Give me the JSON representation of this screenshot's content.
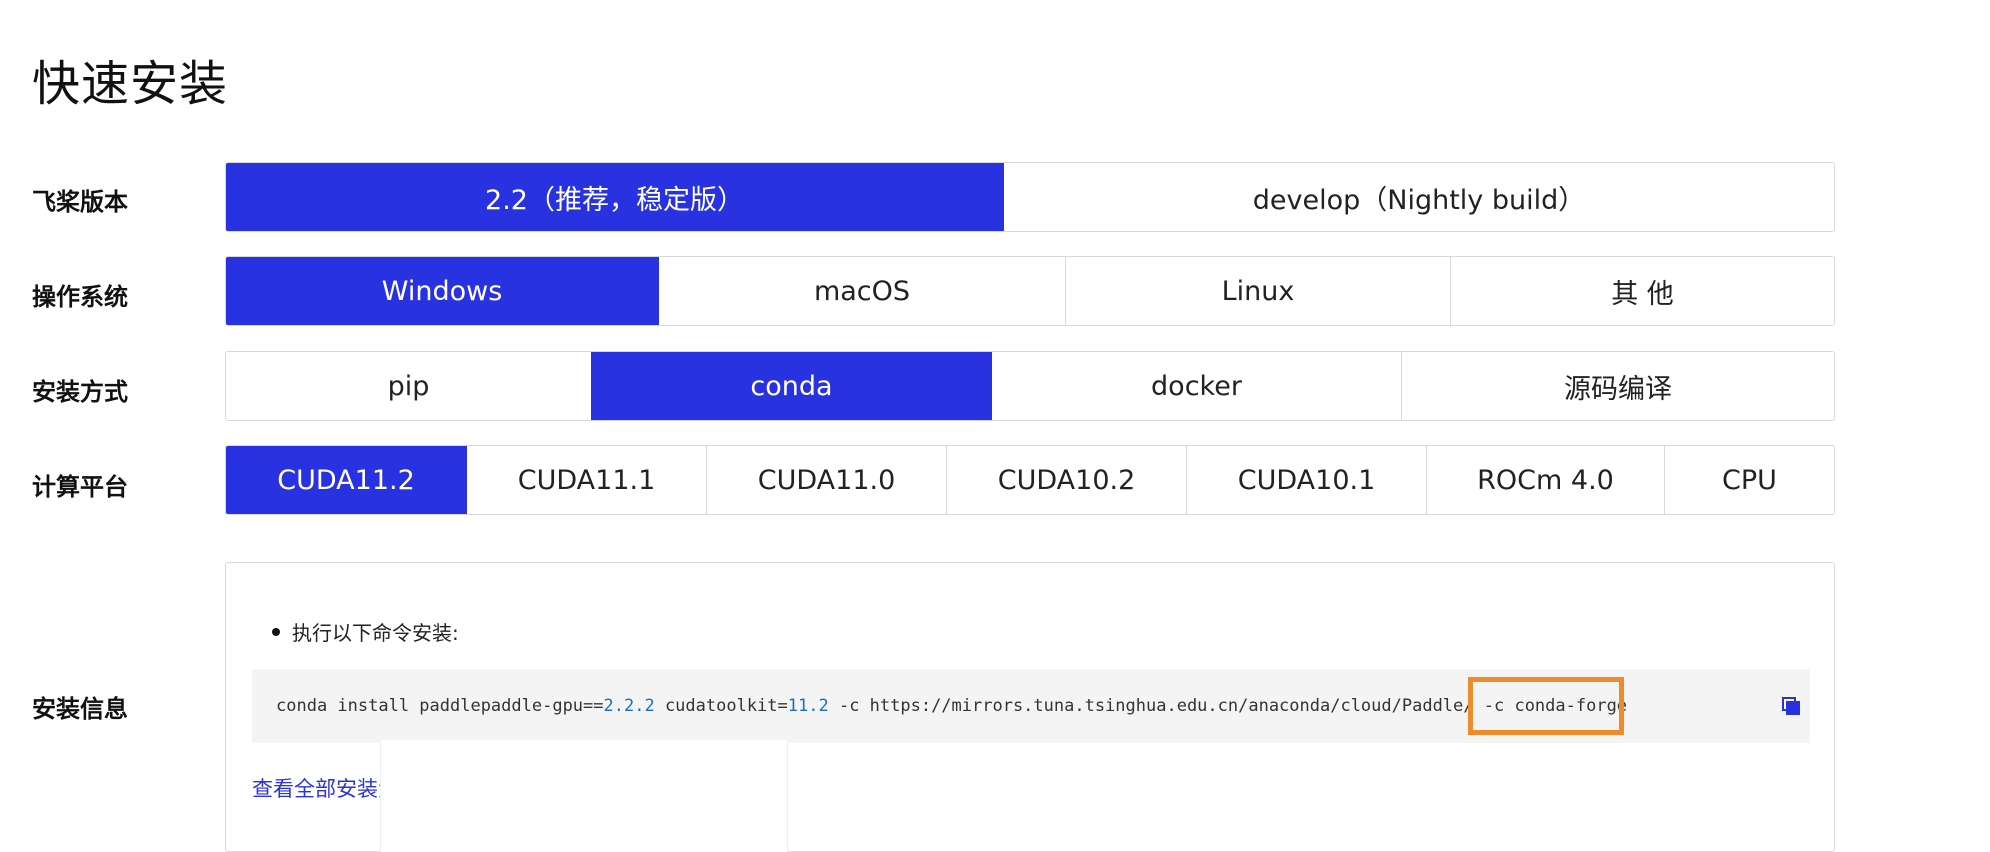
{
  "title": "快速安装",
  "rows": {
    "version": {
      "label": "飞桨版本",
      "options": [
        "2.2（推荐，稳定版）",
        "develop（Nightly build）"
      ],
      "selected": "2.2（推荐，稳定版）"
    },
    "os": {
      "label": "操作系统",
      "options": [
        "Windows",
        "macOS",
        "Linux",
        "其 他"
      ],
      "selected": "Windows"
    },
    "method": {
      "label": "安装方式",
      "options": [
        "pip",
        "conda",
        "docker",
        "源码编译"
      ],
      "selected": "conda"
    },
    "platform": {
      "label": "计算平台",
      "options": [
        "CUDA11.2",
        "CUDA11.1",
        "CUDA11.0",
        "CUDA10.2",
        "CUDA10.1",
        "ROCm 4.0",
        "CPU"
      ],
      "selected": "CUDA11.2"
    }
  },
  "info": {
    "label": "安装信息",
    "bullet": "执行以下命令安装:",
    "command": {
      "part1": "conda install paddlepaddle-gpu==",
      "num1": "2.2.2",
      "part2": " cudatoolkit=",
      "num2": "11.2",
      "part3": " -c https://mirrors.tuna.tsinghua.edu.cn/anaconda/cloud/Paddle/ -c conda-forge"
    },
    "copy_icon": "copy-icon",
    "link": "查看全部安装步骤"
  },
  "colors": {
    "accent": "#2932e1",
    "highlight": "#f08a2e"
  }
}
